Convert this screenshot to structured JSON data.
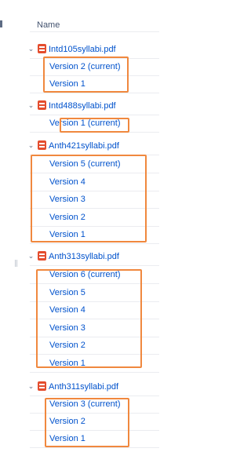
{
  "header": {
    "name_column": "Name"
  },
  "highlight_color": "#f0883e",
  "link_color": "#0052cc",
  "files": [
    {
      "name": "Intd105syllabi.pdf",
      "icon": "pdf-icon",
      "expanded_icon": "chevron-down-icon",
      "versions": [
        "Version 2 (current)",
        "Version 1"
      ]
    },
    {
      "name": "Intd488syllabi.pdf",
      "icon": "pdf-icon",
      "expanded_icon": "chevron-down-icon",
      "versions": [
        "Version 1 (current)"
      ]
    },
    {
      "name": "Anth421syllabi.pdf",
      "icon": "pdf-icon",
      "expanded_icon": "chevron-down-icon",
      "versions": [
        "Version 5 (current)",
        "Version 4",
        "Version 3",
        "Version 2",
        "Version 1"
      ]
    },
    {
      "name": "Anth313syllabi.pdf",
      "icon": "pdf-icon",
      "expanded_icon": "chevron-down-icon",
      "versions": [
        "Version 6 (current)",
        "Version 5",
        "Version 4",
        "Version 3",
        "Version 2",
        "Version 1"
      ]
    },
    {
      "name": "Anth311syllabi.pdf",
      "icon": "pdf-icon",
      "expanded_icon": "chevron-down-icon",
      "versions": [
        "Version 3 (current)",
        "Version 2",
        "Version 1"
      ]
    }
  ]
}
